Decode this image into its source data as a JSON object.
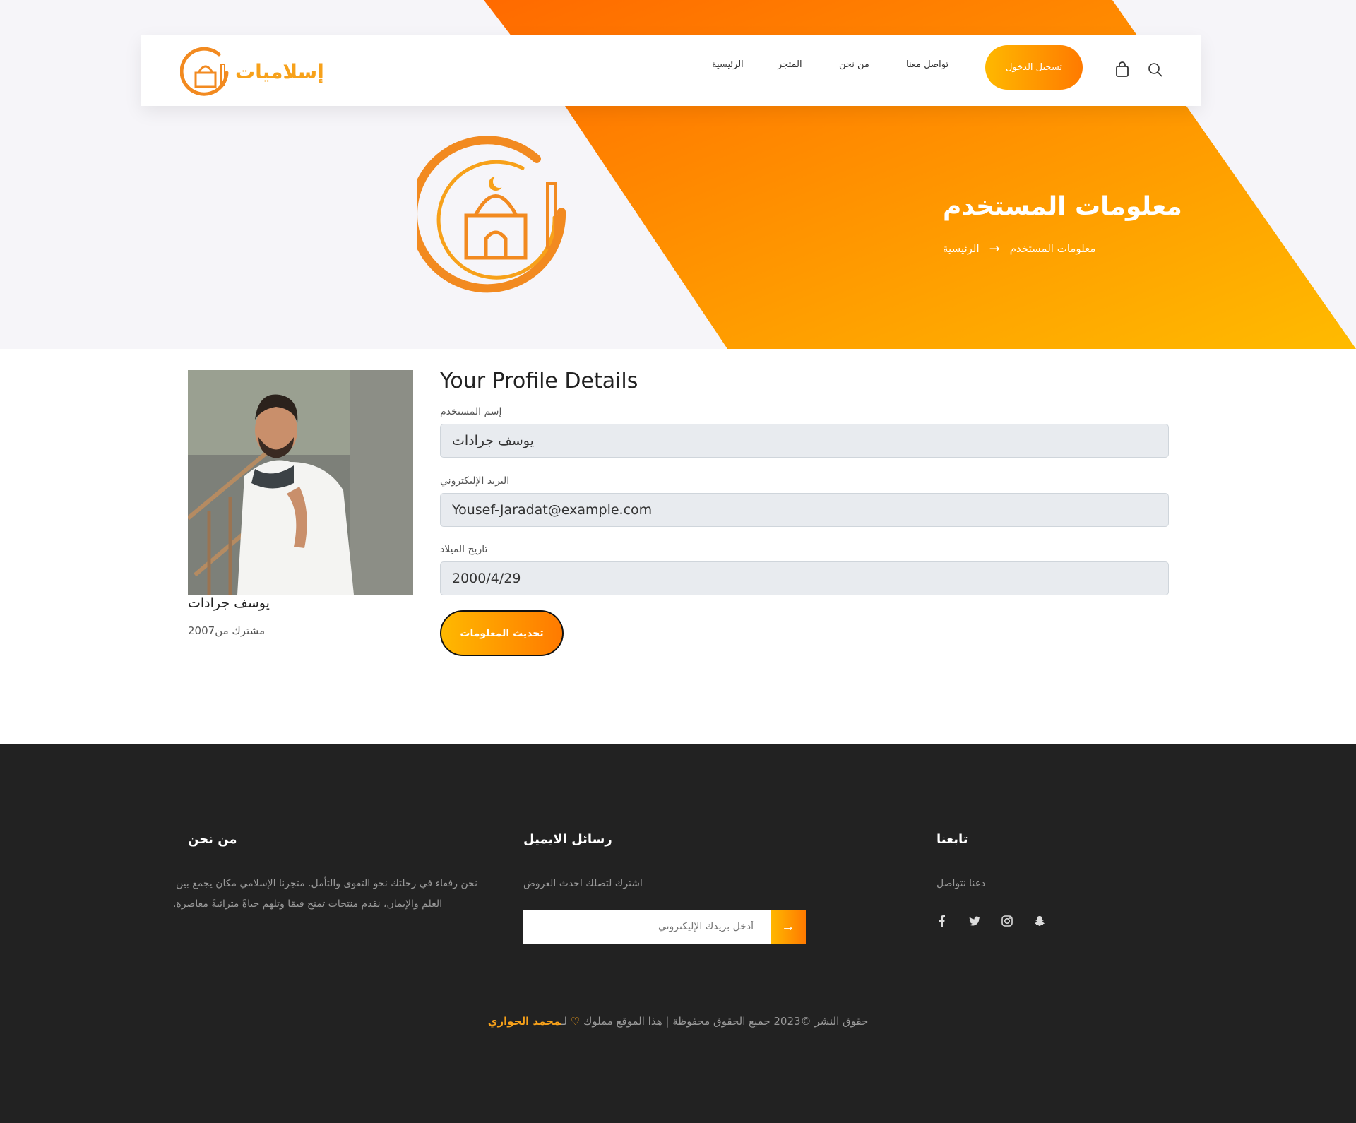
{
  "brand": {
    "name": "إسلاميات"
  },
  "nav": {
    "links": [
      "الرئيسية",
      "المتجر",
      "من نحن",
      "تواصل معنا"
    ],
    "login_label": "تسجيل الدخول"
  },
  "hero": {
    "title": "معلومات المستخدم",
    "breadcrumb_home": "الرئيسية",
    "breadcrumb_current": "معلومات المستخدم"
  },
  "profile": {
    "name": "يوسف جرادات",
    "member_since": "مشترك من2007",
    "form_title": "Your Profile Details",
    "fields": [
      {
        "label": "إسم المستخدم",
        "value": "يوسف جرادات"
      },
      {
        "label": "البريد الإليكتروني",
        "value": "Yousef-Jaradat@example.com"
      },
      {
        "label": "تاريخ الميلاد",
        "value": "2000/4/29"
      }
    ],
    "update_label": "تحديث المعلومات"
  },
  "footer": {
    "about": {
      "title": "من نحن",
      "line1": "نحن رفقاء في رحلتك نحو التقوى والتأمل. متجرنا الإسلامي مكان يجمع بين",
      "line2": "العلم والإيمان، نقدم منتجات تمنح قيمًا وتلهم حياةً متراثيةً معاصرة."
    },
    "newsletter": {
      "title": "رسائل الايميل",
      "text": "اشترك لتصلك احدث العروض",
      "placeholder": "أدخل بريدك الإليكتروني"
    },
    "follow": {
      "title": "تابعنا",
      "text": "دعنا نتواصل",
      "icons": [
        "facebook-icon",
        "twitter-icon",
        "instagram-icon",
        "snapchat-icon"
      ]
    },
    "copyright": "حقوق النشر ©2023 جميع الحقوق محفوظة | هذا الموقع مملوك",
    "copyright_by": "لـ",
    "author": "محمد الحواري"
  },
  "colors": {
    "accent_start": "#ffb800",
    "accent_end": "#ff7a00",
    "footer_bg": "#222222"
  }
}
